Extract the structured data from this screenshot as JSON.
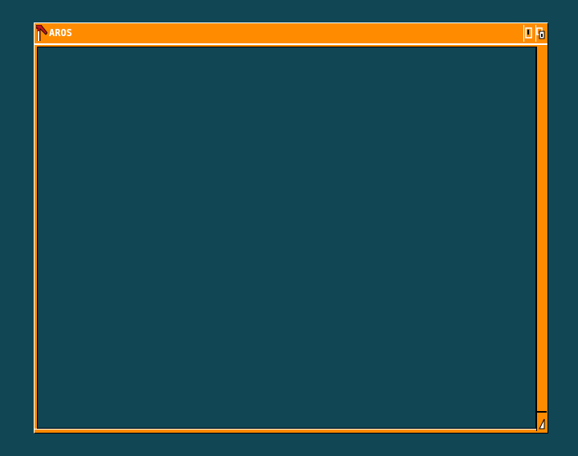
{
  "window": {
    "title": "AROS",
    "colors": {
      "desktop": "#114654",
      "frame": "#FF8C00",
      "highlight": "#FFFFFF",
      "shadow": "#000000",
      "close_gadget": "#C0161C"
    },
    "gadgets": {
      "close": "close-icon",
      "zoom": "zoom-icon",
      "depth": "depth-icon",
      "size": "resize-icon"
    }
  }
}
